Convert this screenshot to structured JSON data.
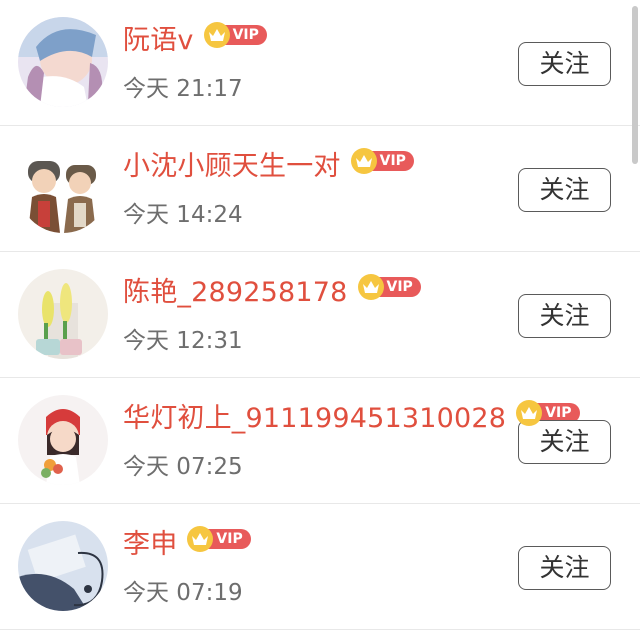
{
  "follow_label": "关注",
  "vip_label": "VIP",
  "users": [
    {
      "name": "阮语v",
      "time": "今天 21:17"
    },
    {
      "name": "小沈小顾天生一对",
      "time": "今天 14:24"
    },
    {
      "name": "陈艳_289258178",
      "time": "今天 12:31"
    },
    {
      "name": "华灯初上_911199451310028",
      "time": "今天 07:25"
    },
    {
      "name": "李申",
      "time": "今天 07:19"
    }
  ],
  "colors": {
    "name": "#e04f3e",
    "time": "#6e6e6e",
    "vip_tag": "#e85a5a",
    "vip_crown": "#f6c640"
  },
  "icons": [
    "crown-icon",
    "avatar-image"
  ]
}
